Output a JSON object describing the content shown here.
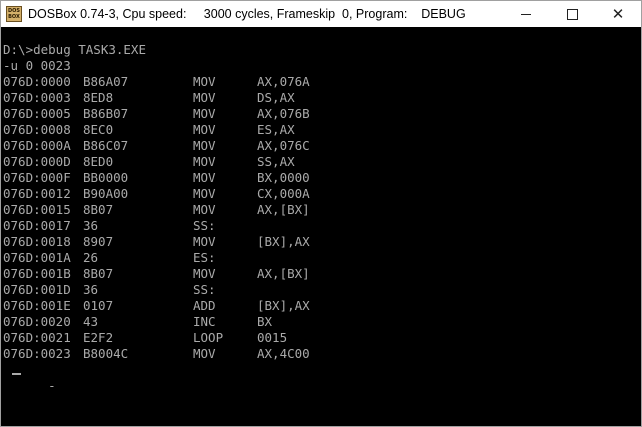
{
  "window": {
    "title": "DOSBox 0.74-3, Cpu speed:     3000 cycles, Frameskip  0, Program:    DEBUG",
    "icon_label_top": "DOS",
    "icon_label_bottom": "BOX",
    "controls": {
      "minimize": "minimize-icon",
      "maximize": "maximize-icon",
      "close": "✕"
    }
  },
  "console": {
    "command_line": "D:\\>debug TASK3.EXE",
    "debug_command": "-u 0 0023",
    "listing": [
      {
        "addr": "076D:0000",
        "hex": "B86A07",
        "mnemonic": "MOV",
        "operands": "AX,076A"
      },
      {
        "addr": "076D:0003",
        "hex": "8ED8",
        "mnemonic": "MOV",
        "operands": "DS,AX"
      },
      {
        "addr": "076D:0005",
        "hex": "B86B07",
        "mnemonic": "MOV",
        "operands": "AX,076B"
      },
      {
        "addr": "076D:0008",
        "hex": "8EC0",
        "mnemonic": "MOV",
        "operands": "ES,AX"
      },
      {
        "addr": "076D:000A",
        "hex": "B86C07",
        "mnemonic": "MOV",
        "operands": "AX,076C"
      },
      {
        "addr": "076D:000D",
        "hex": "8ED0",
        "mnemonic": "MOV",
        "operands": "SS,AX"
      },
      {
        "addr": "076D:000F",
        "hex": "BB0000",
        "mnemonic": "MOV",
        "operands": "BX,0000"
      },
      {
        "addr": "076D:0012",
        "hex": "B90A00",
        "mnemonic": "MOV",
        "operands": "CX,000A"
      },
      {
        "addr": "076D:0015",
        "hex": "8B07",
        "mnemonic": "MOV",
        "operands": "AX,[BX]"
      },
      {
        "addr": "076D:0017",
        "hex": "36",
        "mnemonic": "SS:",
        "operands": ""
      },
      {
        "addr": "076D:0018",
        "hex": "8907",
        "mnemonic": "MOV",
        "operands": "[BX],AX"
      },
      {
        "addr": "076D:001A",
        "hex": "26",
        "mnemonic": "ES:",
        "operands": ""
      },
      {
        "addr": "076D:001B",
        "hex": "8B07",
        "mnemonic": "MOV",
        "operands": "AX,[BX]"
      },
      {
        "addr": "076D:001D",
        "hex": "36",
        "mnemonic": "SS:",
        "operands": ""
      },
      {
        "addr": "076D:001E",
        "hex": "0107",
        "mnemonic": "ADD",
        "operands": "[BX],AX"
      },
      {
        "addr": "076D:0020",
        "hex": "43",
        "mnemonic": "INC",
        "operands": "BX"
      },
      {
        "addr": "076D:0021",
        "hex": "E2F2",
        "mnemonic": "LOOP",
        "operands": "0015"
      },
      {
        "addr": "076D:0023",
        "hex": "B8004C",
        "mnemonic": "MOV",
        "operands": "AX,4C00"
      }
    ],
    "prompt": "-"
  },
  "colors": {
    "console_bg": "#000000",
    "console_fg": "#aaaaaa",
    "titlebar_bg": "#ffffff"
  }
}
